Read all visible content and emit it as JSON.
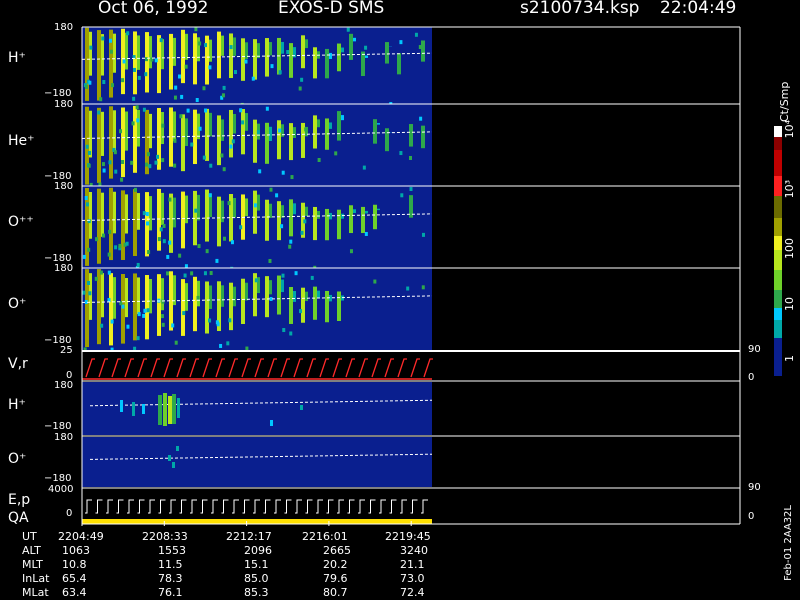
{
  "header": {
    "date": "Oct 06, 1992",
    "instrument": "EXOS-D SMS",
    "filename": "s2100734.ksp",
    "time": "22:04:49"
  },
  "colorbar": {
    "unit": "Ct/Smp",
    "labels": [
      "1",
      "10",
      "100",
      "10³",
      "10⁴"
    ]
  },
  "footer_id": "Feb-01 2AA32L",
  "colors": {
    "background": "#000000",
    "axis": "#ffffff",
    "fill": "#0a1f8f",
    "qa_bar": "#ffe000",
    "velocity": "#ff2a2a"
  },
  "chart_data": {
    "type": "heatmap",
    "x_ticks": [
      "2204:49",
      "2208:33",
      "2212:17",
      "2216:01",
      "2219:45"
    ],
    "panels": [
      {
        "name": "H⁺",
        "ylim": [
          -180,
          180
        ],
        "top": "180",
        "bottom": "−180"
      },
      {
        "name": "He⁺",
        "ylim": [
          -180,
          180
        ],
        "top": "180",
        "bottom": "−180"
      },
      {
        "name": "O⁺⁺",
        "ylim": [
          -180,
          180
        ],
        "top": "180",
        "bottom": "−180"
      },
      {
        "name": "O⁺",
        "ylim": [
          -180,
          180
        ],
        "top": "180",
        "bottom": "−180"
      },
      {
        "name": "V,r",
        "top": "25",
        "bottom": "0",
        "right_top": "90",
        "right_bottom": "0"
      },
      {
        "name": "H⁺",
        "ylim": [
          -180,
          180
        ],
        "top": "180",
        "bottom": "−180"
      },
      {
        "name": "O⁺",
        "ylim": [
          -180,
          180
        ],
        "top": "180",
        "bottom": "−180"
      },
      {
        "name": "E,p",
        "name2": "QA",
        "top": "4000",
        "bottom": "0",
        "right_top": "90",
        "right_bottom": "0"
      }
    ],
    "orbit_table": {
      "rows": [
        {
          "label": "UT",
          "values": [
            "2204:49",
            "2208:33",
            "2212:17",
            "2216:01",
            "2219:45"
          ]
        },
        {
          "label": "ALT",
          "values": [
            "1063",
            "1553",
            "2096",
            "2665",
            "3240"
          ]
        },
        {
          "label": "MLT",
          "values": [
            "10.8",
            "11.5",
            "15.1",
            "20.2",
            "21.1"
          ]
        },
        {
          "label": "InLat",
          "values": [
            "65.4",
            "78.3",
            "85.0",
            "79.6",
            "73.0"
          ]
        },
        {
          "label": "MLat",
          "values": [
            "63.4",
            "76.1",
            "85.3",
            "80.7",
            "72.4"
          ]
        }
      ]
    }
  }
}
